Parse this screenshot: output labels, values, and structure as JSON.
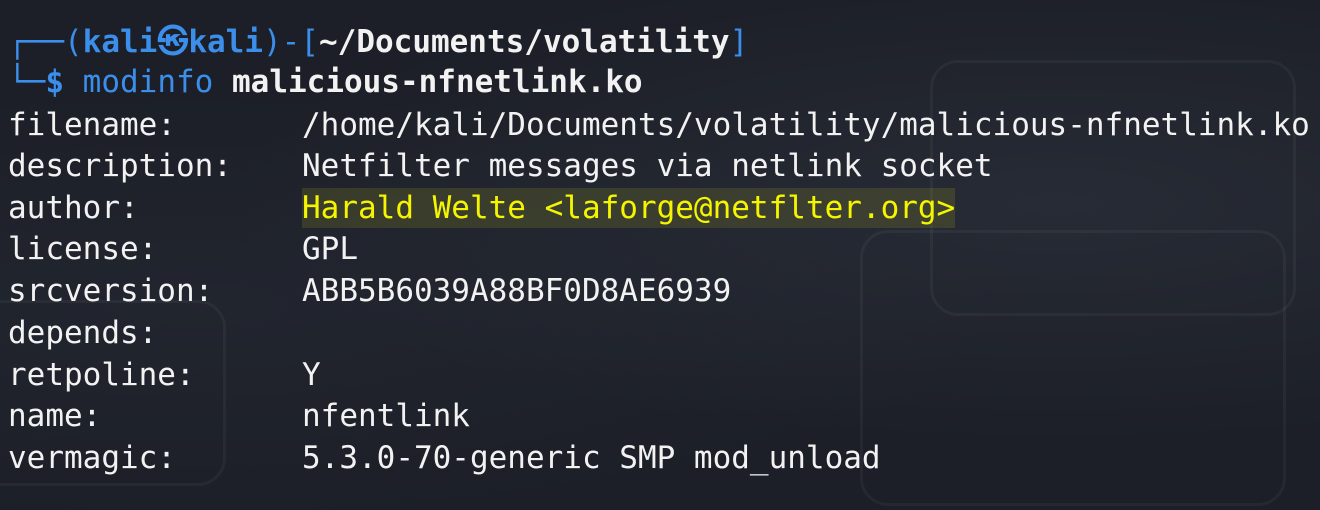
{
  "prompt": {
    "corner_top": "┌──",
    "corner_bottom": "└─",
    "open_paren": "(",
    "user": "kali",
    "at_symbol": "㉿",
    "host": "kali",
    "close_paren": ")",
    "dash": "-",
    "open_bracket": "[",
    "cwd": "~/Documents/volatility",
    "close_bracket": "]",
    "dollar": "$",
    "command": "modinfo",
    "argument": "malicious-nfnetlink.ko"
  },
  "output": [
    {
      "key": "filename:",
      "value": "/home/kali/Documents/volatility/malicious-nfnetlink.ko"
    },
    {
      "key": "description:",
      "value": "Netfilter messages via netlink socket"
    },
    {
      "key": "author:",
      "value": "Harald Welte <laforge@netflter.org>"
    },
    {
      "key": "license:",
      "value": "GPL"
    },
    {
      "key": "srcversion:",
      "value": "ABB5B6039A88BF0D8AE6939"
    },
    {
      "key": "depends:",
      "value": ""
    },
    {
      "key": "retpoline:",
      "value": "Y"
    },
    {
      "key": "name:",
      "value": "nfentlink"
    },
    {
      "key": "vermagic:",
      "value": "5.3.0-70-generic SMP mod_unload"
    }
  ],
  "colors": {
    "background": "#1c1f27",
    "prompt_blue": "#3b8eea",
    "text": "#f2f2f2",
    "highlight_text": "#f5f500"
  }
}
